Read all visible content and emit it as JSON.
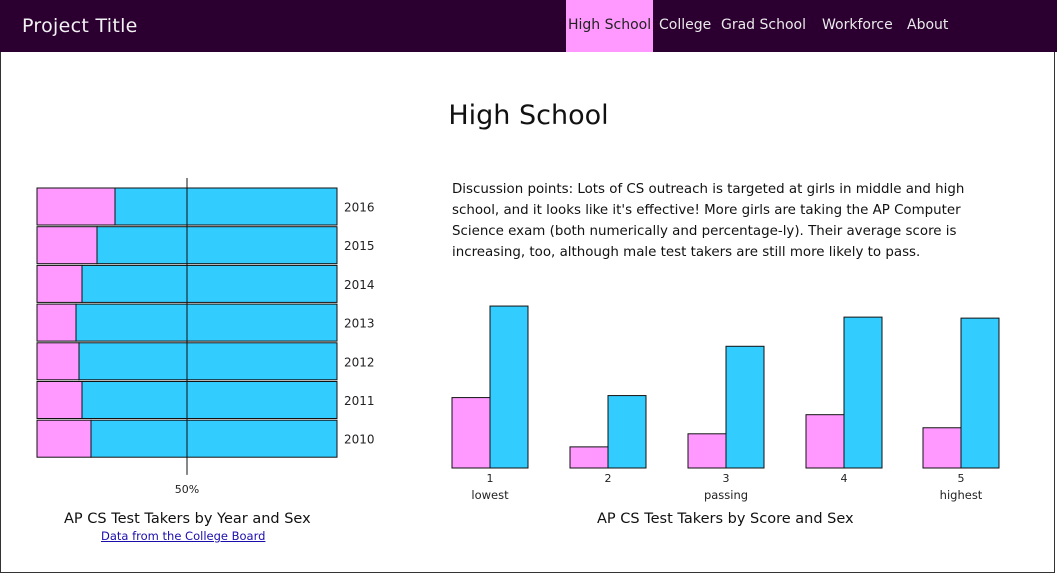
{
  "nav": {
    "brand": "Project Title",
    "items": [
      {
        "label": "High School",
        "active": true
      },
      {
        "label": "College",
        "active": false
      },
      {
        "label": "Grad School",
        "active": false
      },
      {
        "label": "Workforce",
        "active": false
      },
      {
        "label": "About",
        "active": false
      }
    ]
  },
  "page": {
    "title": "High School",
    "discussion": "Discussion points: Lots of CS outreach is targeted at girls in middle and high school, and it looks like it's effective! More girls are taking the AP Computer Science exam (both numerically and percentage-ly). Their average score is increasing, too, although male test takers are still more likely to pass.",
    "source_link": "Data from the College Board"
  },
  "colors": {
    "female": "#ff99ff",
    "male": "#33ccff",
    "nav_bg": "#2b0031"
  },
  "chart_data": [
    {
      "type": "bar",
      "orientation": "horizontal-stacked-percent",
      "title": "AP CS Test Takers by Year and Sex",
      "categories": [
        "2016",
        "2015",
        "2014",
        "2013",
        "2012",
        "2011",
        "2010"
      ],
      "series": [
        {
          "values": [
            26,
            20,
            15,
            13,
            14,
            15,
            18
          ]
        },
        {
          "values": [
            74,
            80,
            85,
            87,
            86,
            85,
            82
          ]
        }
      ],
      "xlim": [
        0,
        100
      ],
      "reference_label": "50%",
      "reference_value": 50
    },
    {
      "type": "bar",
      "orientation": "vertical-grouped",
      "title": "AP CS Test Takers by Score and Sex",
      "categories": [
        "1",
        "2",
        "3",
        "4",
        "5"
      ],
      "category_labels": [
        "lowest",
        "",
        "passing",
        "",
        "highest"
      ],
      "series": [
        {
          "values": [
            70,
            21,
            34,
            53,
            40
          ]
        },
        {
          "values": [
            161,
            72,
            121,
            150,
            149
          ]
        }
      ],
      "ylim": [
        0,
        170
      ]
    }
  ]
}
